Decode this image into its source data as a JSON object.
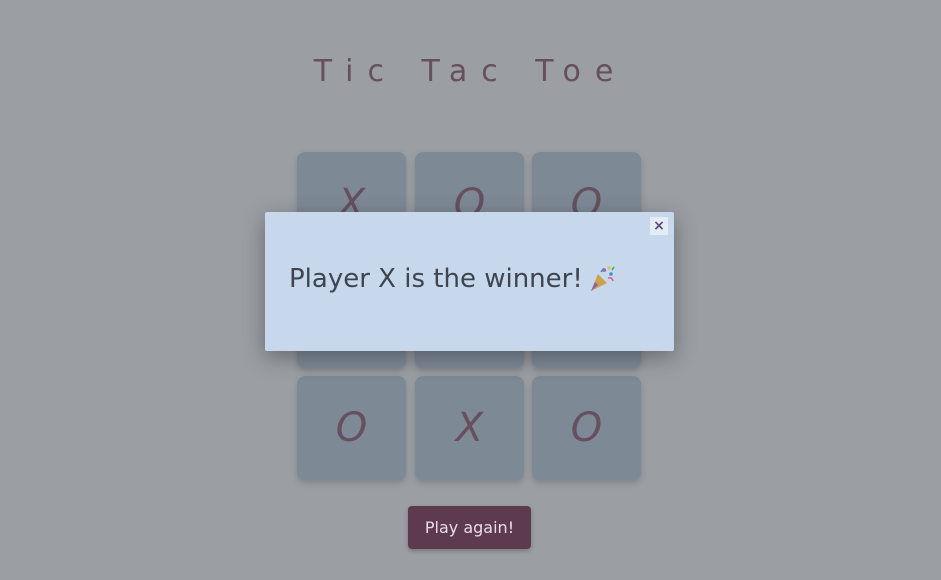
{
  "title": "Tic Tac Toe",
  "board": {
    "cells": [
      "X",
      "O",
      "O",
      "",
      "",
      "",
      "O",
      "X",
      "O"
    ]
  },
  "modal": {
    "message": "Player X is the winner!",
    "icon": "party-popper-icon",
    "close_label": "×"
  },
  "play_again_label": "Play again!",
  "colors": {
    "background": "#a0a4a8",
    "cell": "#7a8797",
    "mark": "#5a3a4c",
    "modal_bg": "#c8d8ec",
    "button_bg": "#5e3a4e"
  }
}
